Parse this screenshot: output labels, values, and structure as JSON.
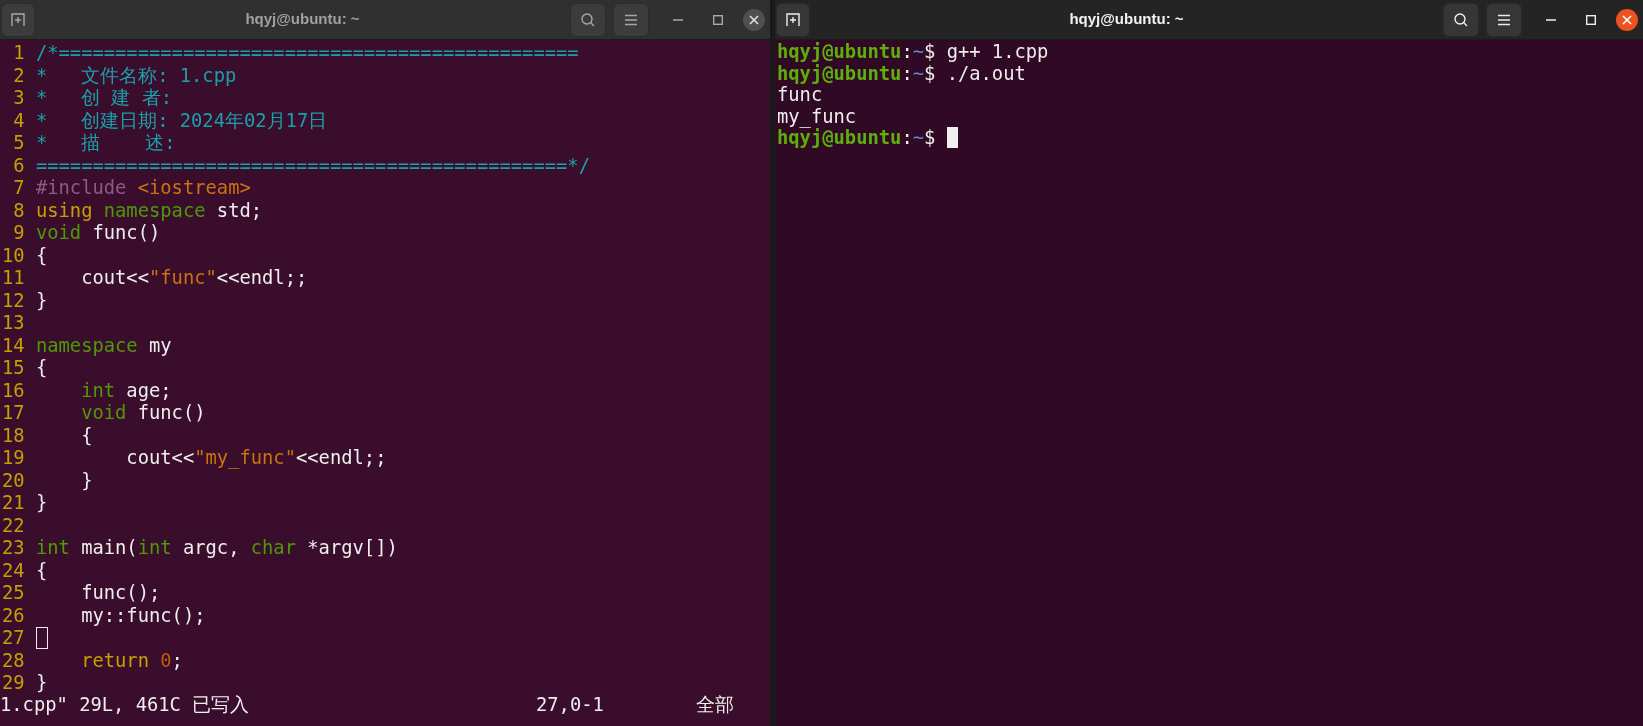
{
  "windows": [
    {
      "kind": "editor",
      "title": "hqyj@ubuntu: ~",
      "active": false,
      "lines": [
        {
          "number": "1",
          "cursor": false,
          "segments": [
            {
              "kind": "comment",
              "text": "/*=============================================="
            }
          ]
        },
        {
          "number": "2",
          "cursor": false,
          "segments": [
            {
              "kind": "comment",
              "text": "*   文件名称: 1.cpp"
            }
          ]
        },
        {
          "number": "3",
          "cursor": false,
          "segments": [
            {
              "kind": "comment",
              "text": "*   创 建 者:"
            }
          ]
        },
        {
          "number": "4",
          "cursor": false,
          "segments": [
            {
              "kind": "comment",
              "text": "*   创建日期: 2024年02月17日"
            }
          ]
        },
        {
          "number": "5",
          "cursor": false,
          "segments": [
            {
              "kind": "comment",
              "text": "*   描    述:"
            }
          ]
        },
        {
          "number": "6",
          "cursor": false,
          "segments": [
            {
              "kind": "comment",
              "text": "===============================================*/"
            }
          ]
        },
        {
          "number": "7",
          "cursor": false,
          "segments": [
            {
              "kind": "preproc",
              "text": "#include"
            },
            {
              "kind": "string",
              "text": " <iostream>"
            }
          ]
        },
        {
          "number": "8",
          "cursor": false,
          "segments": [
            {
              "kind": "statement",
              "text": "using "
            },
            {
              "kind": "keyword",
              "text": "namespace"
            },
            {
              "kind": "plain",
              "text": " std;"
            }
          ]
        },
        {
          "number": "9",
          "cursor": false,
          "segments": [
            {
              "kind": "keyword",
              "text": "void"
            },
            {
              "kind": "plain",
              "text": " func()"
            }
          ]
        },
        {
          "number": "10",
          "cursor": false,
          "segments": [
            {
              "kind": "plain",
              "text": "{"
            }
          ]
        },
        {
          "number": "11",
          "cursor": false,
          "segments": [
            {
              "kind": "plain",
              "text": "    cout<<"
            },
            {
              "kind": "string",
              "text": "\"func\""
            },
            {
              "kind": "plain",
              "text": "<<endl;;"
            }
          ]
        },
        {
          "number": "12",
          "cursor": false,
          "segments": [
            {
              "kind": "plain",
              "text": "}"
            }
          ]
        },
        {
          "number": "13",
          "cursor": false
        },
        {
          "number": "14",
          "cursor": false,
          "segments": [
            {
              "kind": "keyword",
              "text": "namespace"
            },
            {
              "kind": "plain",
              "text": " my"
            }
          ]
        },
        {
          "number": "15",
          "cursor": false,
          "segments": [
            {
              "kind": "plain",
              "text": "{"
            }
          ]
        },
        {
          "number": "16",
          "cursor": false,
          "segments": [
            {
              "kind": "keyword",
              "text": "    int"
            },
            {
              "kind": "plain",
              "text": " age;"
            }
          ]
        },
        {
          "number": "17",
          "cursor": false,
          "segments": [
            {
              "kind": "keyword",
              "text": "    void"
            },
            {
              "kind": "plain",
              "text": " func()"
            }
          ]
        },
        {
          "number": "18",
          "cursor": false,
          "segments": [
            {
              "kind": "plain",
              "text": "    {"
            }
          ]
        },
        {
          "number": "19",
          "cursor": false,
          "segments": [
            {
              "kind": "plain",
              "text": "        cout<<"
            },
            {
              "kind": "string",
              "text": "\"my_func\""
            },
            {
              "kind": "plain",
              "text": "<<endl;;"
            }
          ]
        },
        {
          "number": "20",
          "cursor": false,
          "segments": [
            {
              "kind": "plain",
              "text": "    }"
            }
          ]
        },
        {
          "number": "21",
          "cursor": false,
          "segments": [
            {
              "kind": "plain",
              "text": "}"
            }
          ]
        },
        {
          "number": "22",
          "cursor": false
        },
        {
          "number": "23",
          "cursor": false,
          "segments": [
            {
              "kind": "keyword",
              "text": "int"
            },
            {
              "kind": "plain",
              "text": " main("
            },
            {
              "kind": "keyword",
              "text": "int"
            },
            {
              "kind": "plain",
              "text": " argc, "
            },
            {
              "kind": "keyword",
              "text": "char"
            },
            {
              "kind": "plain",
              "text": " *argv[])"
            }
          ]
        },
        {
          "number": "24",
          "cursor": false,
          "segments": [
            {
              "kind": "plain",
              "text": "{"
            }
          ]
        },
        {
          "number": "25",
          "cursor": false,
          "segments": [
            {
              "kind": "plain",
              "text": "    func();"
            }
          ]
        },
        {
          "number": "26",
          "cursor": false,
          "segments": [
            {
              "kind": "plain",
              "text": "    my::func();"
            }
          ]
        },
        {
          "number": "27",
          "cursor": true
        },
        {
          "number": "28",
          "cursor": false,
          "segments": [
            {
              "kind": "statement",
              "text": "    return"
            },
            {
              "kind": "number",
              "text": " 0"
            },
            {
              "kind": "plain",
              "text": ";"
            }
          ]
        },
        {
          "number": "29",
          "cursor": false,
          "segments": [
            {
              "kind": "plain",
              "text": "}"
            }
          ]
        }
      ],
      "status": {
        "message": "1.cpp\" 29L, 461C 已写入",
        "position": "27,0-1",
        "scroll": "全部"
      }
    },
    {
      "kind": "terminal",
      "title": "hqyj@ubuntu: ~",
      "active": true,
      "lines": [
        {
          "cursor": false,
          "segments": [
            {
              "kind": "user",
              "text": "hqyj@ubuntu"
            },
            {
              "kind": "plain",
              "text": ":"
            },
            {
              "kind": "path",
              "text": "~"
            },
            {
              "kind": "plain",
              "text": "$ g++ 1.cpp"
            }
          ]
        },
        {
          "cursor": false,
          "segments": [
            {
              "kind": "user",
              "text": "hqyj@ubuntu"
            },
            {
              "kind": "plain",
              "text": ":"
            },
            {
              "kind": "path",
              "text": "~"
            },
            {
              "kind": "plain",
              "text": "$ ./a.out"
            }
          ]
        },
        {
          "cursor": false,
          "segments": [
            {
              "kind": "plain",
              "text": "func"
            }
          ]
        },
        {
          "cursor": false,
          "segments": [
            {
              "kind": "plain",
              "text": "my_func"
            }
          ]
        },
        {
          "cursor": true,
          "segments": [
            {
              "kind": "user",
              "text": "hqyj@ubuntu"
            },
            {
              "kind": "plain",
              "text": ":"
            },
            {
              "kind": "path",
              "text": "~"
            },
            {
              "kind": "plain",
              "text": "$ "
            }
          ]
        }
      ]
    }
  ]
}
